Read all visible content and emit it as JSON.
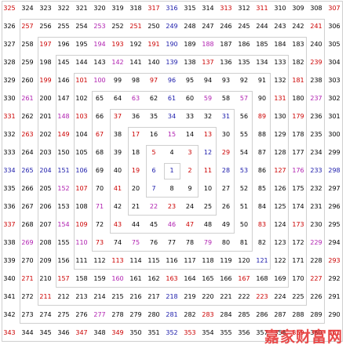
{
  "grid": {
    "title": "",
    "rows": [
      [
        325,
        324,
        323,
        322,
        321,
        320,
        319,
        318,
        317,
        316,
        315,
        314,
        313,
        312,
        311,
        310,
        309,
        308,
        307
      ],
      [
        326,
        257,
        256,
        255,
        254,
        253,
        252,
        251,
        250,
        249,
        248,
        247,
        246,
        245,
        244,
        243,
        242,
        241,
        306
      ],
      [
        327,
        258,
        197,
        196,
        195,
        194,
        193,
        192,
        191,
        190,
        189,
        188,
        187,
        186,
        185,
        184,
        183,
        240,
        305
      ],
      [
        328,
        259,
        198,
        145,
        144,
        143,
        142,
        141,
        140,
        139,
        138,
        137,
        136,
        135,
        134,
        133,
        182,
        239,
        304
      ],
      [
        329,
        260,
        199,
        146,
        101,
        100,
        99,
        98,
        97,
        96,
        95,
        94,
        93,
        92,
        91,
        132,
        181,
        238,
        303
      ],
      [
        330,
        261,
        200,
        147,
        102,
        65,
        64,
        63,
        62,
        61,
        60,
        59,
        58,
        57,
        90,
        131,
        180,
        237,
        302
      ],
      [
        331,
        262,
        201,
        148,
        103,
        66,
        37,
        36,
        35,
        34,
        33,
        32,
        31,
        56,
        89,
        130,
        179,
        236,
        301
      ],
      [
        332,
        263,
        202,
        149,
        104,
        67,
        38,
        17,
        16,
        15,
        14,
        13,
        30,
        55,
        88,
        129,
        178,
        235,
        300
      ],
      [
        333,
        264,
        203,
        150,
        105,
        68,
        39,
        18,
        5,
        4,
        3,
        12,
        29,
        54,
        87,
        128,
        177,
        234,
        299
      ],
      [
        334,
        265,
        204,
        151,
        106,
        69,
        40,
        19,
        6,
        1,
        2,
        11,
        28,
        53,
        86,
        127,
        176,
        233,
        298
      ],
      [
        335,
        266,
        205,
        152,
        107,
        70,
        41,
        20,
        7,
        8,
        9,
        10,
        27,
        52,
        85,
        126,
        175,
        232,
        297
      ],
      [
        336,
        267,
        206,
        153,
        108,
        71,
        42,
        21,
        22,
        23,
        24,
        25,
        26,
        51,
        84,
        125,
        174,
        231,
        296
      ],
      [
        337,
        268,
        207,
        154,
        109,
        72,
        43,
        44,
        45,
        46,
        47,
        48,
        49,
        50,
        83,
        124,
        173,
        230,
        295
      ],
      [
        338,
        269,
        208,
        155,
        110,
        73,
        74,
        75,
        76,
        77,
        78,
        79,
        80,
        81,
        82,
        123,
        172,
        229,
        294
      ],
      [
        339,
        270,
        209,
        156,
        111,
        112,
        113,
        114,
        115,
        116,
        117,
        118,
        119,
        120,
        121,
        122,
        171,
        228,
        293
      ],
      [
        340,
        271,
        210,
        157,
        158,
        159,
        160,
        161,
        162,
        163,
        164,
        165,
        166,
        167,
        168,
        169,
        170,
        227,
        292
      ],
      [
        341,
        272,
        211,
        212,
        213,
        214,
        215,
        216,
        217,
        218,
        219,
        220,
        221,
        222,
        223,
        224,
        225,
        226,
        291
      ],
      [
        342,
        273,
        274,
        275,
        276,
        277,
        278,
        279,
        280,
        281,
        282,
        283,
        284,
        285,
        286,
        287,
        288,
        289,
        290
      ],
      [
        343,
        344,
        345,
        346,
        347,
        348,
        349,
        350,
        351,
        352,
        353,
        354,
        355,
        356,
        357,
        358,
        359,
        360,
        361
      ]
    ],
    "colors": {
      "default": "#000000",
      "red": "#cc0000",
      "blue": "#1a1aaa",
      "magenta": "#b020b0"
    },
    "red_numbers": [
      2,
      3,
      5,
      7,
      11,
      13,
      17,
      19,
      23,
      29,
      31,
      37,
      41,
      43,
      47,
      53,
      59,
      61,
      67,
      71,
      73,
      79,
      83,
      89,
      97,
      101,
      103,
      107,
      109,
      113,
      127,
      131,
      137,
      139,
      149,
      151,
      157,
      163,
      167,
      173,
      179,
      181,
      191,
      193,
      197,
      199,
      211,
      223,
      227,
      229,
      233,
      239,
      241,
      251,
      257,
      263,
      269,
      271,
      277,
      281,
      283,
      293,
      307,
      311,
      313,
      317,
      331,
      337,
      347,
      349,
      353,
      359,
      325,
      343,
      361
    ],
    "blue_numbers": [
      1,
      6,
      7,
      12,
      28,
      31,
      34,
      53,
      61,
      96,
      106,
      121,
      139,
      151,
      190,
      204,
      218,
      233,
      249,
      265,
      281,
      298,
      316,
      334,
      352
    ],
    "magenta_numbers": [
      15,
      22,
      46,
      57,
      59,
      63,
      71,
      75,
      79,
      100,
      110,
      142,
      148,
      152,
      154,
      160,
      176,
      188,
      194,
      229,
      237,
      253,
      261,
      269,
      277
    ]
  },
  "watermark": {
    "text": "嘉家财富网"
  }
}
